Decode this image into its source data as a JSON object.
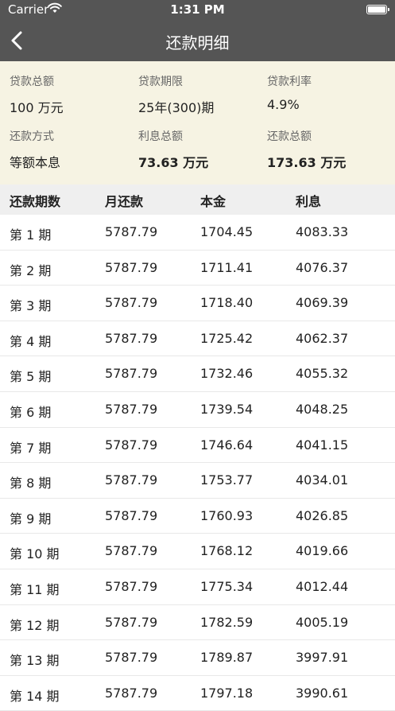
{
  "status_bar": {
    "carrier": "Carrier",
    "time": "1:31 PM"
  },
  "nav": {
    "title": "还款明细"
  },
  "summary": {
    "items": [
      {
        "label": "贷款总额",
        "value": "100 万元"
      },
      {
        "label": "贷款期限",
        "value": "25年(300)期"
      },
      {
        "label": "贷款利率",
        "value": "4.9%"
      },
      {
        "label": "还款方式",
        "value": "等额本息"
      },
      {
        "label": "利息总额",
        "value": "73.63 万元"
      },
      {
        "label": "还款总额",
        "value": "173.63 万元"
      }
    ]
  },
  "table": {
    "headers": [
      "还款期数",
      "月还款",
      "本金",
      "利息"
    ],
    "rows": [
      [
        "第 1 期",
        "5787.79",
        "1704.45",
        "4083.33"
      ],
      [
        "第 2 期",
        "5787.79",
        "1711.41",
        "4076.37"
      ],
      [
        "第 3 期",
        "5787.79",
        "1718.40",
        "4069.39"
      ],
      [
        "第 4 期",
        "5787.79",
        "1725.42",
        "4062.37"
      ],
      [
        "第 5 期",
        "5787.79",
        "1732.46",
        "4055.32"
      ],
      [
        "第 6 期",
        "5787.79",
        "1739.54",
        "4048.25"
      ],
      [
        "第 7 期",
        "5787.79",
        "1746.64",
        "4041.15"
      ],
      [
        "第 8 期",
        "5787.79",
        "1753.77",
        "4034.01"
      ],
      [
        "第 9 期",
        "5787.79",
        "1760.93",
        "4026.85"
      ],
      [
        "第 10 期",
        "5787.79",
        "1768.12",
        "4019.66"
      ],
      [
        "第 11 期",
        "5787.79",
        "1775.34",
        "4012.44"
      ],
      [
        "第 12 期",
        "5787.79",
        "1782.59",
        "4005.19"
      ],
      [
        "第 13 期",
        "5787.79",
        "1789.87",
        "3997.91"
      ],
      [
        "第 14 期",
        "5787.79",
        "1797.18",
        "3990.61"
      ]
    ]
  }
}
